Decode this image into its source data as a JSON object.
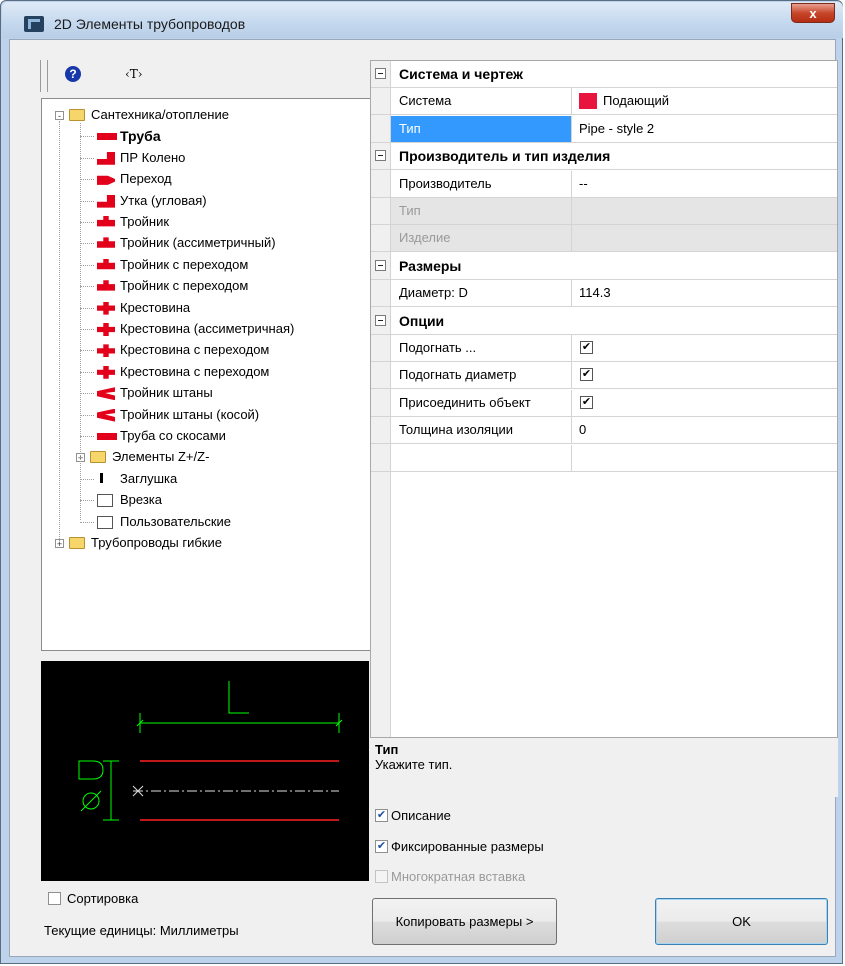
{
  "window": {
    "title": "2D Элементы трубопроводов",
    "close_glyph": "x"
  },
  "toolbar": {
    "help_glyph": "?",
    "text_tool_glyph": "‹T›"
  },
  "tree": {
    "items": [
      {
        "label": "Сантехника/отопление",
        "type": "folder",
        "expander": "-",
        "bold": false
      },
      {
        "label": "Труба",
        "type": "item",
        "bold": true,
        "icon": "pipe-icon"
      },
      {
        "label": "ПР Колено",
        "type": "item",
        "icon": "elbow-icon"
      },
      {
        "label": "Переход",
        "type": "item",
        "icon": "reducer-icon"
      },
      {
        "label": "Утка (угловая)",
        "type": "item",
        "icon": "offset-icon"
      },
      {
        "label": "Тройник",
        "type": "item",
        "icon": "tee-icon"
      },
      {
        "label": "Тройник (ассиметричный)",
        "type": "item",
        "icon": "tee-icon"
      },
      {
        "label": "Тройник с переходом",
        "type": "item",
        "icon": "tee-icon"
      },
      {
        "label": "Тройник с переходом",
        "type": "item",
        "icon": "tee-icon"
      },
      {
        "label": "Крестовина",
        "type": "item",
        "icon": "cross-icon"
      },
      {
        "label": "Крестовина (ассиметричная)",
        "type": "item",
        "icon": "cross-icon"
      },
      {
        "label": "Крестовина с переходом",
        "type": "item",
        "icon": "cross-icon"
      },
      {
        "label": "Крестовина с переходом",
        "type": "item",
        "icon": "cross-icon"
      },
      {
        "label": "Тройник штаны",
        "type": "item",
        "icon": "y-branch-icon"
      },
      {
        "label": "Тройник штаны (косой)",
        "type": "item",
        "icon": "y-branch-icon"
      },
      {
        "label": "Труба со скосами",
        "type": "item",
        "icon": "pipe-icon"
      },
      {
        "label": "Элементы Z+/Z-",
        "type": "subfolder",
        "expander": "+"
      },
      {
        "label": "Заглушка",
        "type": "item",
        "icon": "cap-icon"
      },
      {
        "label": "Врезка",
        "type": "item",
        "icon": "tap-icon"
      },
      {
        "label": "Пользовательские",
        "type": "item",
        "icon": "user-defined-icon"
      },
      {
        "label": "Трубопроводы гибкие",
        "type": "folder",
        "expander": "+"
      }
    ]
  },
  "preview": {
    "dimension_label": "L",
    "diameter_label": "ØD",
    "colors": {
      "dimension": "#00ff00",
      "pipe": "#ff0000",
      "axis": "#ffffff"
    }
  },
  "left_bottom": {
    "sort_label": "Сортировка",
    "sort_checked": false,
    "units_text": "Текущие единицы: Миллиметры"
  },
  "grid": {
    "categories": [
      {
        "title": "Система и чертеж",
        "props": [
          {
            "name": "Система",
            "value": "Подающий",
            "swatch": "#e8163e"
          },
          {
            "name": "Тип",
            "value": "Pipe - style 2",
            "selected": true
          }
        ]
      },
      {
        "title": "Производитель и тип изделия",
        "props": [
          {
            "name": "Производитель",
            "value": "--"
          },
          {
            "name": "Тип",
            "value": "",
            "disabled": true
          },
          {
            "name": "Изделие",
            "value": "",
            "disabled": true
          }
        ]
      },
      {
        "title": "Размеры",
        "props": [
          {
            "name": "Диаметр: D",
            "value": "114.3"
          }
        ]
      },
      {
        "title": "Опции",
        "props": [
          {
            "name": "Подогнать ...",
            "checkbox": true
          },
          {
            "name": "Подогнать диаметр",
            "checkbox": true
          },
          {
            "name": "Присоединить объект",
            "checkbox": true
          },
          {
            "name": "Толщина изоляции",
            "value": "0"
          },
          {
            "name": "",
            "value": ""
          }
        ]
      }
    ],
    "check_glyph": "✔"
  },
  "description": {
    "title": "Тип",
    "text": "Укажите тип."
  },
  "options": {
    "description_label": "Описание",
    "description_checked": true,
    "fixed_sizes_label": "Фиксированные размеры",
    "fixed_sizes_checked": true,
    "multi_insert_label": "Многократная вставка",
    "multi_insert_checked": false,
    "multi_insert_disabled": true
  },
  "buttons": {
    "copy_sizes": "Копировать размеры >",
    "ok": "OK"
  }
}
